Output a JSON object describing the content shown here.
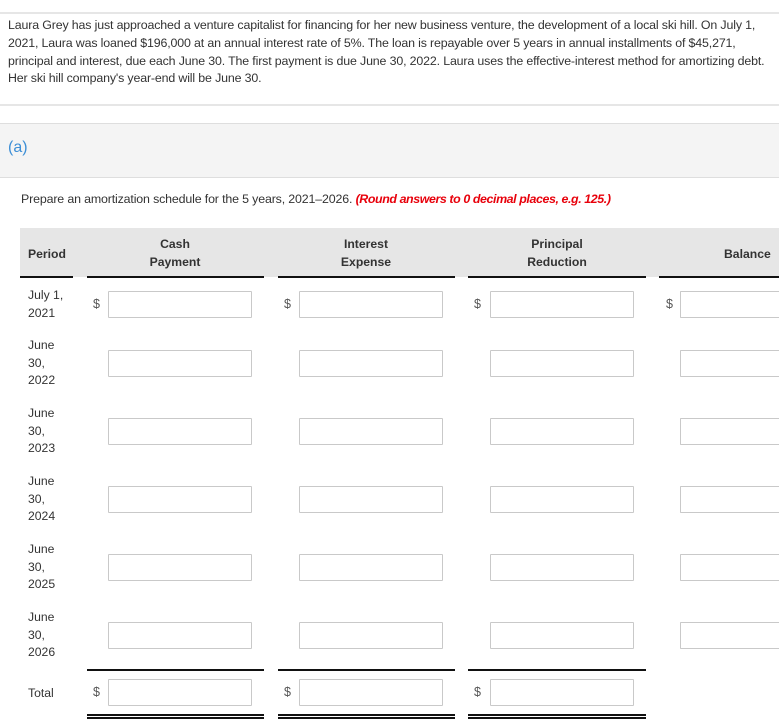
{
  "problem": {
    "text": "Laura Grey has just approached a venture capitalist for financing for her new business venture, the development of a local ski hill. On July 1, 2021, Laura was loaned $196,000 at an annual interest rate of 5%. The loan is repayable over 5 years in annual installments of $45,271, principal and interest, due each June 30. The first payment is due June 30, 2022. Laura uses the effective-interest method for amortizing debt. Her ski hill company's year-end will be June 30."
  },
  "part": {
    "label": "(a)"
  },
  "instruction": {
    "text": "Prepare an amortization schedule for the 5 years, 2021–2026.",
    "hint": "(Round answers to 0 decimal places, e.g. 125.)"
  },
  "table": {
    "headers": {
      "period": "Period",
      "cash_payment": [
        "Cash",
        "Payment"
      ],
      "interest_expense": [
        "Interest",
        "Expense"
      ],
      "principal_reduction": [
        "Principal",
        "Reduction"
      ],
      "balance": "Balance"
    },
    "currency_symbol": "$",
    "rows": [
      {
        "period": [
          "July 1,",
          "2021"
        ],
        "cash_payment": "",
        "interest_expense": "",
        "principal_reduction": "",
        "balance": ""
      },
      {
        "period": [
          "June",
          "30,",
          "2022"
        ],
        "cash_payment": "",
        "interest_expense": "",
        "principal_reduction": "",
        "balance": ""
      },
      {
        "period": [
          "June",
          "30,",
          "2023"
        ],
        "cash_payment": "",
        "interest_expense": "",
        "principal_reduction": "",
        "balance": ""
      },
      {
        "period": [
          "June",
          "30,",
          "2024"
        ],
        "cash_payment": "",
        "interest_expense": "",
        "principal_reduction": "",
        "balance": ""
      },
      {
        "period": [
          "June",
          "30,",
          "2025"
        ],
        "cash_payment": "",
        "interest_expense": "",
        "principal_reduction": "",
        "balance": ""
      },
      {
        "period": [
          "June",
          "30,",
          "2026"
        ],
        "cash_payment": "",
        "interest_expense": "",
        "principal_reduction": "",
        "balance": ""
      }
    ],
    "total": {
      "label": "Total",
      "cash_payment": "",
      "interest_expense": "",
      "principal_reduction": ""
    }
  }
}
